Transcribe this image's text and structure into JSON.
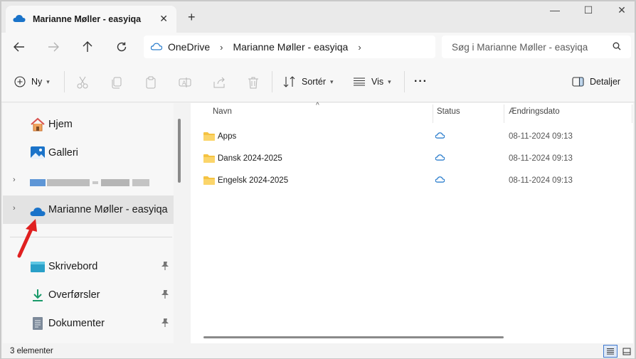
{
  "window": {
    "tab_title": "Marianne Møller - easyiqa",
    "tab_close": "✕",
    "new_tab": "+",
    "controls": [
      "—",
      "☐",
      "✕"
    ]
  },
  "address": {
    "crumbs": [
      "OneDrive",
      "Marianne Møller - easyiqa"
    ],
    "search_placeholder": "Søg i Marianne Møller - easyiqa"
  },
  "commands": {
    "new": "Ny",
    "sort": "Sortér",
    "view": "Vis",
    "more": "···",
    "details": "Detaljer"
  },
  "nav": {
    "home": "Hjem",
    "gallery": "Galleri",
    "onedrive": "Marianne Møller - easyiqa",
    "desktop": "Skrivebord",
    "downloads": "Overførsler",
    "documents": "Dokumenter"
  },
  "columns": {
    "name": "Navn",
    "status": "Status",
    "modified": "Ændringsdato"
  },
  "files": [
    {
      "name": "Apps",
      "status_icon": "cloud-icon",
      "modified": "08-11-2024 09:13"
    },
    {
      "name": "Dansk 2024-2025",
      "status_icon": "cloud-icon",
      "modified": "08-11-2024 09:13"
    },
    {
      "name": "Engelsk 2024-2025",
      "status_icon": "cloud-icon",
      "modified": "08-11-2024 09:13"
    }
  ],
  "status": {
    "item_count": "3 elementer"
  },
  "colors": {
    "accent": "#1a73c9",
    "folder": "#f5c342",
    "annotation_arrow": "#e02020"
  }
}
